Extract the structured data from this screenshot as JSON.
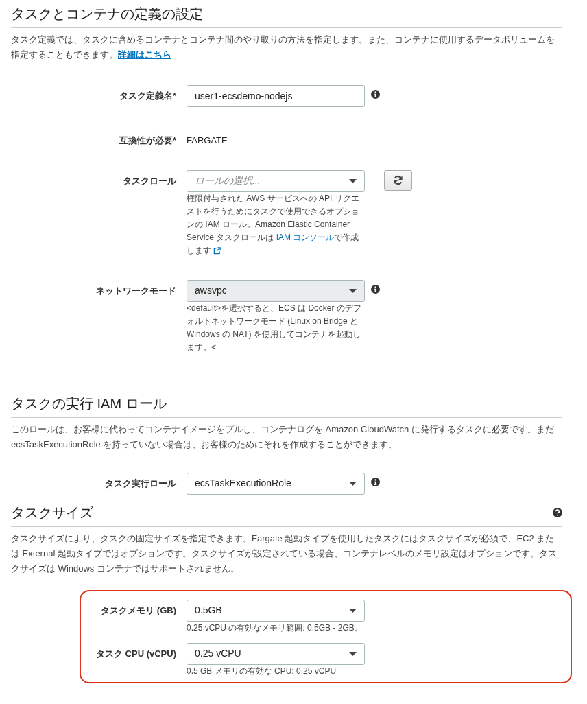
{
  "sections": [
    {
      "title": "タスクとコンテナの定義の設定",
      "description": "タスク定義では、タスクに含めるコンテナとコンテナ間のやり取りの方法を指定します。また、コンテナに使用するデータボリュームを指定することもできます。",
      "description_link": "詳細はこちら",
      "fields": [
        {
          "kind": "input",
          "label": "タスク定義名*",
          "value": "user1-ecsdemo-nodejs",
          "info": true
        },
        {
          "kind": "static",
          "label": "互換性が必要*",
          "value": "FARGATE"
        },
        {
          "kind": "select",
          "label": "タスクロール",
          "placeholder": "ロールの選択...",
          "disabled": false,
          "refresh": true,
          "help": "権限付与された AWS サービスへの API リクエストを行うためにタスクで使用できるオプションの IAM ロール。Amazon Elastic Container Service タスクロールは ",
          "help_link": "IAM コンソール",
          "help_after": "で作成します",
          "external_icon": true
        },
        {
          "kind": "select",
          "label": "ネットワークモード",
          "value": "awsvpc",
          "disabled": true,
          "info": true,
          "help": "<default>を選択すると、ECS は Docker のデフォルトネットワークモード (Linux on Bridge と Windows の NAT) を使用してコンテナを起動します。<"
        }
      ]
    },
    {
      "title": "タスクの実行 IAM ロール",
      "description": "このロールは、お客様に代わってコンテナイメージをプルし、コンテナログを Amazon CloudWatch に発行するタスクに必要です。まだ ecsTaskExecutionRole を持っていない場合は、お客様のためにそれを作成することができます。",
      "fields": [
        {
          "kind": "select",
          "label": "タスク実行ロール",
          "value": "ecsTaskExecutionRole",
          "disabled": false,
          "info": true
        }
      ]
    },
    {
      "title": "タスクサイズ",
      "help_icon": true,
      "description": "タスクサイズにより、タスクの固定サイズを指定できます。Fargate 起動タイプを使用したタスクにはタスクサイズが必須で、EC2 または External 起動タイプではオプションです。タスクサイズが設定されている場合、コンテナレベルのメモリ設定はオプションです。タスクサイズは Windows コンテナではサポートされません。",
      "highlighted": true,
      "fields": [
        {
          "kind": "select",
          "label": "タスクメモリ (GB)",
          "value": "0.5GB",
          "disabled": false,
          "help": "0.25 vCPU の有効なメモリ範囲: 0.5GB - 2GB。"
        },
        {
          "kind": "select",
          "label": "タスク CPU (vCPU)",
          "value": "0.25 vCPU",
          "disabled": false,
          "help": "0.5 GB メモリの有効な CPU: 0.25 vCPU"
        }
      ]
    }
  ]
}
